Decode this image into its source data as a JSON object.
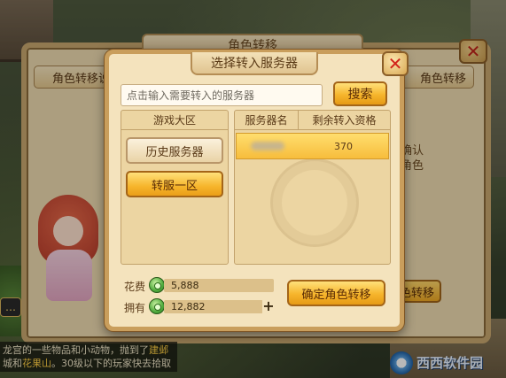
{
  "background": {
    "panel_title": "角色转移",
    "tab_left_label": "角色转移说",
    "tab_right_label": "角色转移",
    "side_text_1": "确认",
    "side_text_2": "角色",
    "side_button_label": "色转移",
    "chat_line_1_a": "龙宫的一些物品和小动物，抛到了",
    "chat_line_1_hl": "建邺",
    "chat_line_2_a": "城和",
    "chat_line_2_hl": "花果山",
    "chat_line_2_b": "。30级以下的玩家快去拾取",
    "watermark": "西西软件园"
  },
  "dialog": {
    "title": "选择转入服务器",
    "search_placeholder": "点击输入需要转入的服务器",
    "search_button": "搜索",
    "region_header": "游戏大区",
    "regions": [
      {
        "label": "历史服务器",
        "selected": false
      },
      {
        "label": "转服一区",
        "selected": true
      }
    ],
    "server_columns": {
      "name": "服务器名",
      "remaining": "剩余转入资格"
    },
    "servers": [
      {
        "remaining": "370",
        "selected": true
      }
    ],
    "cost_label": "花费",
    "cost_value": "5,888",
    "owned_label": "拥有",
    "owned_value": "12,882",
    "confirm_button": "确定角色转移"
  },
  "colors": {
    "button_gold": "#f6b52c",
    "panel_bg": "#f4e3bd",
    "close_red": "#d1231a"
  },
  "icons": {
    "close": "close-icon",
    "coin": "coin-icon",
    "plus": "plus-icon"
  }
}
